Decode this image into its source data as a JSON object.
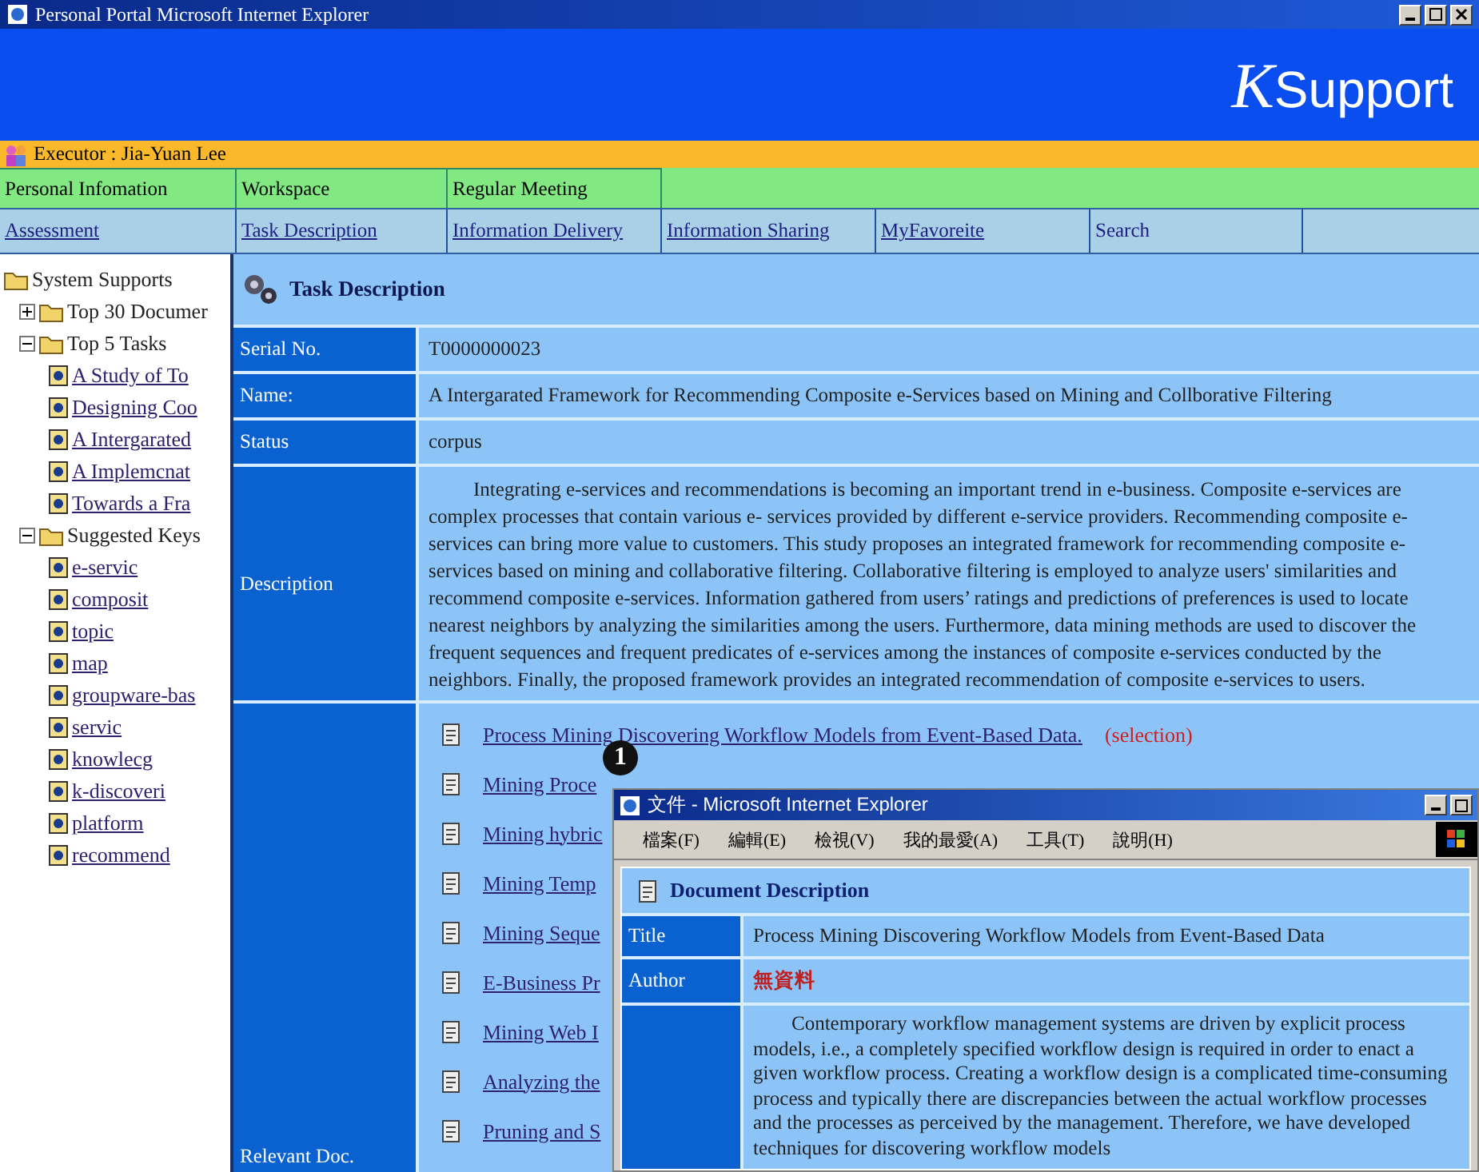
{
  "window": {
    "title": "Personal Portal  Microsoft Internet Explorer"
  },
  "banner": {
    "logo_initial": "K",
    "logo_text": "Support"
  },
  "executor": "Executor : Jia-Yuan Lee",
  "nav_row_1": [
    "Personal Infomation",
    "Workspace",
    "Regular Meeting"
  ],
  "nav_row_2": [
    {
      "label": "Assessment",
      "link": true
    },
    {
      "label": "Task Description",
      "link": true
    },
    {
      "label": "Information Delivery",
      "link": true
    },
    {
      "label": "Information Sharing",
      "link": true
    },
    {
      "label": "MyFavoreite",
      "link": true
    },
    {
      "label": "Search",
      "link": false
    }
  ],
  "tree": [
    {
      "label": "System Supports",
      "kind": "folder",
      "children": [
        {
          "label": "Top 30 Documer",
          "kind": "folder",
          "expanded": false
        },
        {
          "label": "Top 5 Tasks",
          "kind": "folder",
          "expanded": true,
          "children": [
            {
              "label": "A Study of To",
              "kind": "page"
            },
            {
              "label": "Designing Coo",
              "kind": "page"
            },
            {
              "label": "A Intergarated",
              "kind": "page"
            },
            {
              "label": "A Implemcnat",
              "kind": "page"
            },
            {
              "label": "Towards a Fra",
              "kind": "page"
            }
          ]
        },
        {
          "label": "Suggested Keys",
          "kind": "folder",
          "expanded": true,
          "children": [
            {
              "label": "e-servic",
              "kind": "page"
            },
            {
              "label": "composit",
              "kind": "page"
            },
            {
              "label": "topic",
              "kind": "page"
            },
            {
              "label": "map",
              "kind": "page"
            },
            {
              "label": "groupware-bas",
              "kind": "page"
            },
            {
              "label": "servic",
              "kind": "page"
            },
            {
              "label": "knowlecg",
              "kind": "page"
            },
            {
              "label": "k-discoveri",
              "kind": "page"
            },
            {
              "label": "platform",
              "kind": "page"
            },
            {
              "label": "recommend",
              "kind": "page"
            }
          ]
        }
      ]
    }
  ],
  "task": {
    "title": "Task Description",
    "fields": [
      {
        "label": "Serial No.",
        "value": "T0000000023",
        "kind": "text"
      },
      {
        "label": "Name:",
        "value": "A Intergarated Framework for Recommending Composite e-Services based on Mining and Collborative Filtering",
        "kind": "text"
      },
      {
        "label": "Status",
        "value": "corpus",
        "kind": "text"
      },
      {
        "label": "Description",
        "value": "Integrating e-services and recommendations is becoming an important trend in e-business. Composite e-services are complex processes that contain various e- services provided by different e-service providers. Recommending composite e- services can bring more value to customers. This study proposes an integrated framework for recommending composite e-services based on mining and collaborative filtering. Collaborative filtering is employed to analyze users' similarities and recommend composite e-services. Information gathered from users’ ratings and predictions of preferences is used to locate nearest neighbors by analyzing the similarities among the users. Furthermore, data mining methods are used to discover the frequent sequences and frequent predicates of e-services among the instances of composite e-services conducted by the neighbors. Finally, the proposed framework provides an integrated recommendation of composite e-services to users.",
        "kind": "paragraph"
      }
    ],
    "relevant_label": "Relevant Doc.",
    "documents": [
      {
        "title": "Process Mining Discovering Workflow Models from Event-Based Data.",
        "note": "(selection)"
      },
      {
        "title": "Mining Proce"
      },
      {
        "title": "Mining hybric"
      },
      {
        "title": "Mining Temp"
      },
      {
        "title": "Mining Seque"
      },
      {
        "title": "E-Business Pr"
      },
      {
        "title": "Mining Web I"
      },
      {
        "title": "Analyzing the"
      },
      {
        "title": "Pruning and S"
      }
    ]
  },
  "marker": "1",
  "popup": {
    "title": "文件 - Microsoft Internet Explorer",
    "menu": [
      "檔案(F)",
      "編輯(E)",
      "檢視(V)",
      "我的最愛(A)",
      "工具(T)",
      "說明(H)"
    ],
    "heading": "Document Description",
    "fields": [
      {
        "label": "Title",
        "value": "Process Mining Discovering Workflow Models from Event-Based Data",
        "kind": "text"
      },
      {
        "label": "Author",
        "value": "無資料",
        "kind": "missing"
      }
    ],
    "description": "Contemporary workflow management systems are driven by explicit process models, i.e., a completely specified workflow design is required in order to enact a given workflow process. Creating a workflow design is a complicated time-consuming process and typically there are discrepancies between the actual workflow processes and the processes as perceived by the management. Therefore, we have developed techniques for discovering workflow models"
  }
}
